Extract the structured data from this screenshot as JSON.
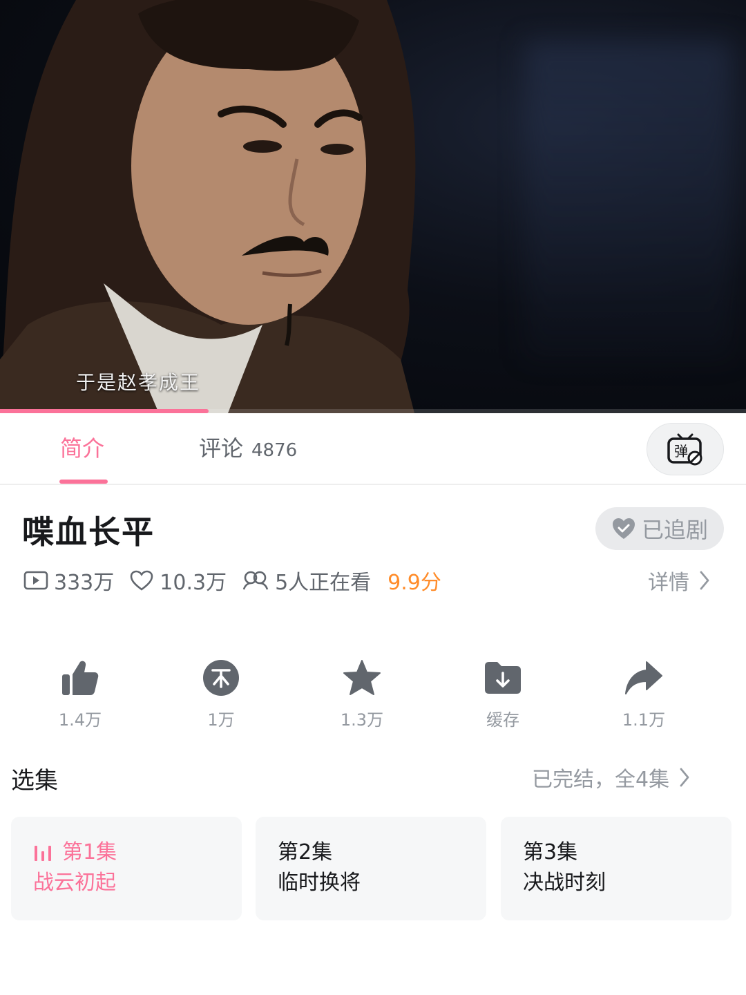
{
  "player": {
    "subtitle": "于是赵孝成王",
    "progress_fraction": 0.28,
    "accent_color": "#fb7299"
  },
  "tabs": {
    "intro_label": "简介",
    "comments_label": "评论",
    "comments_count": "4876",
    "danmaku_icon": "danmaku-toggle-icon"
  },
  "show": {
    "title": "喋血长平",
    "follow_label": "已追剧",
    "views": "333万",
    "likes": "10.3万",
    "watching": "5人正在看",
    "rating": "9.9分",
    "detail_label": "详情"
  },
  "actions": [
    {
      "icon": "thumbs-up-icon",
      "label": "1.4万"
    },
    {
      "icon": "coin-icon",
      "label": "1万"
    },
    {
      "icon": "star-icon",
      "label": "1.3万"
    },
    {
      "icon": "download-folder-icon",
      "label": "缓存"
    },
    {
      "icon": "share-arrow-icon",
      "label": "1.1万"
    }
  ],
  "episodes": {
    "section_title": "选集",
    "status": "已完结，全4集",
    "items": [
      {
        "number": "第1集",
        "name": "战云初起",
        "active": true
      },
      {
        "number": "第2集",
        "name": "临时换将",
        "active": false
      },
      {
        "number": "第3集",
        "name": "决战时刻",
        "active": false
      }
    ]
  }
}
